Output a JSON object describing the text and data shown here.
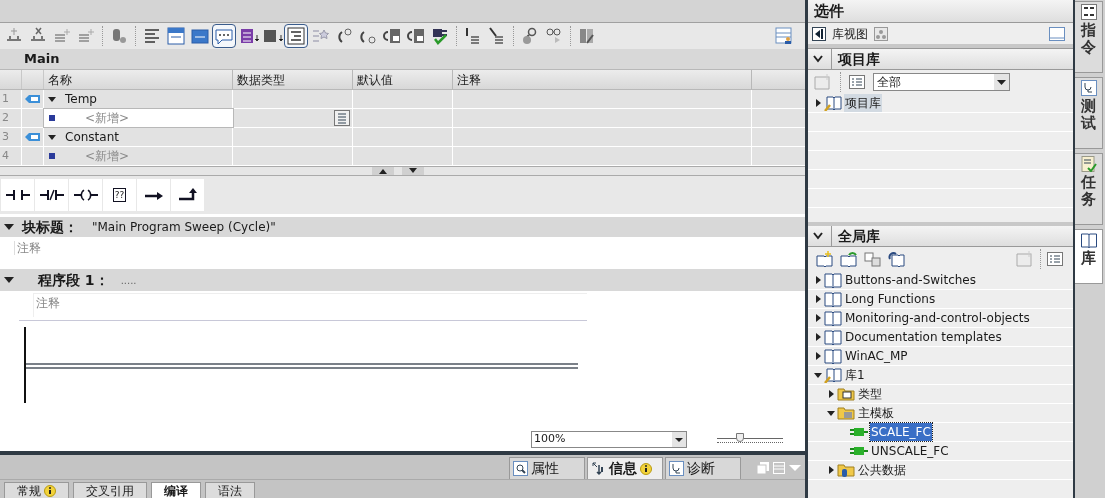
{
  "editor_toolbar": [
    {
      "pressed": false
    },
    {
      "pressed": false
    },
    {
      "pressed": false
    },
    {
      "pressed": false
    },
    {
      "pressed": false
    },
    {
      "pressed": false
    },
    {
      "pressed": false
    },
    {
      "pressed": false
    },
    {
      "pressed": true
    },
    {
      "pressed": false
    },
    {
      "pressed": false
    },
    {
      "pressed": true
    },
    {
      "pressed": false
    },
    {
      "pressed": false
    },
    {
      "pressed": false
    },
    {
      "pressed": false
    },
    {
      "pressed": false
    },
    {
      "pressed": false
    },
    {
      "pressed": false
    },
    {
      "pressed": false
    },
    {
      "pressed": false
    },
    {
      "pressed": false
    },
    {
      "pressed": false
    }
  ],
  "block_name": "Main",
  "interface_table": {
    "columns": [
      "名称",
      "数据类型",
      "默认值",
      "注释"
    ],
    "rows": [
      {
        "number": "1",
        "kind": "section",
        "name": "Temp",
        "expanded": true,
        "selected": false
      },
      {
        "number": "2",
        "kind": "add",
        "name": "<新增>",
        "selected": true
      },
      {
        "number": "3",
        "kind": "section",
        "name": "Constant",
        "expanded": true,
        "selected": false
      },
      {
        "number": "4",
        "kind": "add",
        "name": "<新增>",
        "selected": false
      }
    ]
  },
  "ladder_toolbar": {
    "empty_box_label": "??"
  },
  "block_title": {
    "label": "块标题：",
    "value": "\"Main Program Sweep (Cycle)\"",
    "comment": "注释",
    "expanded": true
  },
  "networks": [
    {
      "label": "程序段 1：",
      "title": ".....",
      "comment": "注释",
      "expanded": true
    }
  ],
  "zoom": {
    "value": "100%",
    "level": 0.35
  },
  "inspector_tabs": [
    {
      "label": "属性",
      "selected": false,
      "info": false
    },
    {
      "label": "信息",
      "selected": true,
      "info": true
    },
    {
      "label": "诊断",
      "selected": false,
      "info": false
    }
  ],
  "bottom_tabs": [
    {
      "label": "常规",
      "selected": false,
      "info": true
    },
    {
      "label": "交叉引用",
      "selected": false,
      "info": false
    },
    {
      "label": "编译",
      "selected": true,
      "info": false
    },
    {
      "label": "语法",
      "selected": false,
      "info": false
    }
  ],
  "options": {
    "title": "选件",
    "library_view": "库视图",
    "project_library": {
      "title": "项目库",
      "expanded": true,
      "filter": "全部",
      "tree": [
        {
          "label": "项目库",
          "kind": "library-edit",
          "expanded": false,
          "selected": true
        }
      ]
    },
    "global_library": {
      "title": "全局库",
      "expanded": true,
      "tree": [
        {
          "label": "Buttons-and-Switches",
          "kind": "library",
          "expanded": false,
          "selected": false
        },
        {
          "label": "Long Functions",
          "kind": "library",
          "expanded": false,
          "selected": false
        },
        {
          "label": "Monitoring-and-control-objects",
          "kind": "library",
          "expanded": false,
          "selected": false
        },
        {
          "label": "Documentation templates",
          "kind": "library",
          "expanded": false,
          "selected": false
        },
        {
          "label": "WinAC_MP",
          "kind": "library",
          "expanded": false,
          "selected": false
        },
        {
          "label": "库1",
          "kind": "library-edit",
          "expanded": true,
          "selected": false,
          "children": [
            {
              "label": "类型",
              "kind": "types-folder",
              "expanded": false,
              "selected": false
            },
            {
              "label": "主模板",
              "kind": "folder",
              "expanded": true,
              "selected": false,
              "children": [
                {
                  "label": "SCALE_FC",
                  "kind": "block",
                  "selected": true
                },
                {
                  "label": "UNSCALE_FC",
                  "kind": "block",
                  "selected": false
                }
              ]
            },
            {
              "label": "公共数据",
              "kind": "data-folder",
              "expanded": false,
              "selected": false
            }
          ]
        }
      ]
    }
  },
  "side_tabs": [
    {
      "label": "指令",
      "selected": false
    },
    {
      "label": "测试",
      "selected": false
    },
    {
      "label": "任务",
      "selected": false
    },
    {
      "label": "库",
      "selected": true
    }
  ]
}
